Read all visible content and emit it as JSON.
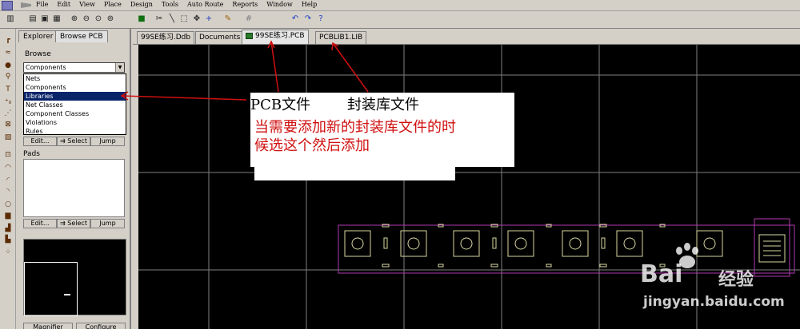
{
  "menubar": {
    "items": [
      "File",
      "Edit",
      "View",
      "Place",
      "Design",
      "Tools",
      "Auto Route",
      "Reports",
      "Window",
      "Help"
    ]
  },
  "toolbar": {
    "icons": [
      "new-icon",
      "open-icon",
      "save-icon",
      "print-icon",
      "zoom-in-icon",
      "zoom-out-icon",
      "zoom-fit-icon",
      "zoom-area-icon",
      "browse-icon",
      "cut-icon",
      "wire-icon",
      "select-icon",
      "move-icon",
      "cross-icon",
      "pencil-icon",
      "grid-icon",
      "undo-icon",
      "redo-icon",
      "help-icon"
    ]
  },
  "panel": {
    "tabs": [
      "Explorer",
      "Browse PCB"
    ],
    "browse_label": "Browse",
    "combo_value": "Components",
    "dropdown_items": [
      "Nets",
      "Components",
      "Libraries",
      "Net Classes",
      "Component Classes",
      "Violations",
      "Rules"
    ],
    "selected_item": "Libraries",
    "buttons": [
      "Edit...",
      "Select",
      "Jump"
    ],
    "pads_label": "Pads",
    "pad_buttons": [
      "Edit...",
      "Select",
      "Jump"
    ],
    "bottom_buttons": [
      "Magnifier",
      "Configure"
    ]
  },
  "doc_tabs": [
    "99SE练习.Ddb",
    "Documents",
    "99SE练习.PCB",
    "PCBLIB1.LIB"
  ],
  "annotation": {
    "label_pcb": "PCB文件",
    "label_lib": "封装库文件",
    "note": "当需要添加新的封装库文件的时候选这个然后添加"
  },
  "watermark": {
    "brand": "Bai",
    "brand_suffix": "经验",
    "url": "jingyan.baidu.com"
  },
  "colors": {
    "canvas_bg": "#000000",
    "grid": "#7f7f7f",
    "component_outline": "#b03ab0",
    "silk": "#d8d8a0",
    "annotation_text": "#d01010",
    "arrow": "#d01010",
    "selection": "#0a246a"
  }
}
